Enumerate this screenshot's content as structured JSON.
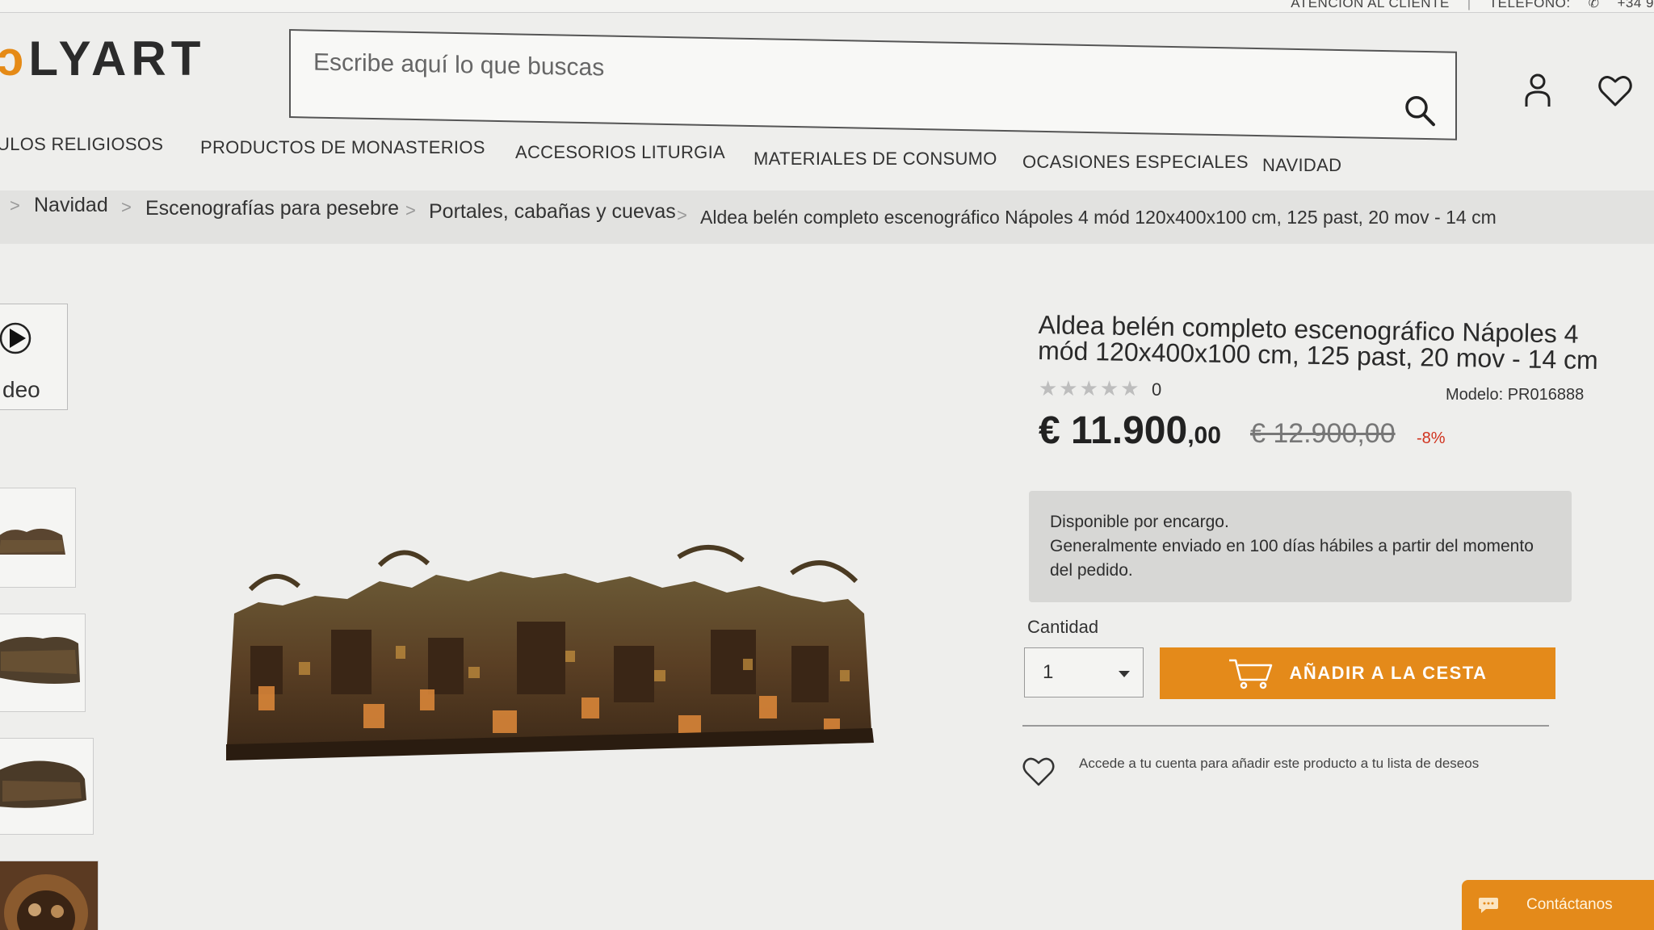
{
  "topbar": {
    "customer_service": "ATENCIÓN AL CLIENTE",
    "phone_label": "TELÉFONO:",
    "phone_number": "+34 9"
  },
  "header": {
    "logo_text": "LYART",
    "search_placeholder": "Escribe aquí lo que buscas"
  },
  "nav": {
    "items": [
      "ULOS RELIGIOSOS",
      "PRODUCTOS DE MONASTERIOS",
      "ACCESORIOS LITURGIA",
      "MATERIALES DE CONSUMO",
      "OCASIONES ESPECIALES",
      "NAVIDAD"
    ]
  },
  "breadcrumb": {
    "items": [
      "Navidad",
      "Escenografías para pesebre",
      "Portales, cabañas y cuevas",
      "Aldea belén completo escenográfico Nápoles 4 mód 120x400x100 cm, 125 past, 20 mov - 14 cm"
    ],
    "separator": ">"
  },
  "gallery": {
    "video_label": "deo"
  },
  "product": {
    "title": "Aldea belén completo escenográfico Nápoles 4 mód 120x400x100 cm, 125 past, 20 mov - 14 cm",
    "rating_stars": "★★★★★",
    "rating": 0,
    "review_count": "0",
    "model": "Modelo: PR016888",
    "price_main": "€ 11.900",
    "price_decimals": ",00",
    "old_price": "€ 12.900,00",
    "discount": "-8%",
    "availability_line1": "Disponible por encargo.",
    "availability_line2": "Generalmente enviado en 100 días hábiles a partir del momento del pedido.",
    "quantity_label": "Cantidad",
    "quantity_value": "1",
    "add_to_cart": "AÑADIR A LA CESTA",
    "wishlist_text": "Accede a tu cuenta para añadir este producto a tu lista de deseos"
  },
  "contact": {
    "label": "Contáctanos"
  },
  "colors": {
    "accent": "#e48a1a",
    "discount": "#d0321e",
    "availability_bg": "#d7d7d5"
  }
}
